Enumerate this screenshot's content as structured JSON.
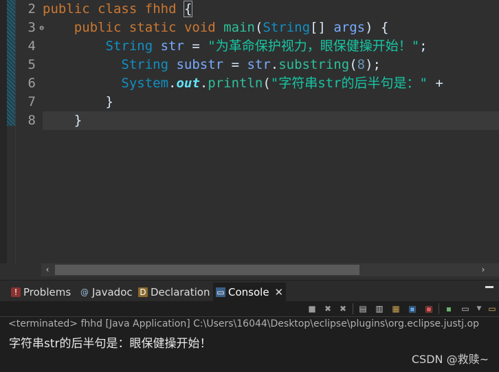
{
  "editor": {
    "line_numbers": [
      "2",
      "3",
      "4",
      "5",
      "6",
      "7",
      "8"
    ],
    "lines": [
      {
        "parts": [
          [
            "kw",
            "public"
          ],
          [
            "plain",
            " "
          ],
          [
            "kw",
            "class"
          ],
          [
            "plain",
            " "
          ],
          [
            "kw",
            "fhhd"
          ],
          [
            "plain",
            " "
          ],
          [
            "brace",
            "{"
          ]
        ]
      },
      {
        "parts": [
          [
            "plain",
            "    "
          ],
          [
            "kw",
            "public"
          ],
          [
            "plain",
            " "
          ],
          [
            "kw",
            "static"
          ],
          [
            "plain",
            " "
          ],
          [
            "kw",
            "void"
          ],
          [
            "plain",
            " "
          ],
          [
            "fn",
            "main"
          ],
          [
            "plain",
            "("
          ],
          [
            "ty",
            "String"
          ],
          [
            "plain",
            "[] "
          ],
          [
            "var",
            "args"
          ],
          [
            "plain",
            ") {"
          ]
        ]
      },
      {
        "parts": [
          [
            "plain",
            "        "
          ],
          [
            "ty",
            "String"
          ],
          [
            "plain",
            " "
          ],
          [
            "var",
            "str"
          ],
          [
            "plain",
            " = "
          ],
          [
            "str",
            "\"为革命保护视力，眼保健操开始！\""
          ],
          [
            "plain",
            ";"
          ]
        ]
      },
      {
        "parts": [
          [
            "plain",
            "          "
          ],
          [
            "ty",
            "String"
          ],
          [
            "plain",
            " "
          ],
          [
            "var",
            "substr"
          ],
          [
            "plain",
            " = "
          ],
          [
            "var",
            "str"
          ],
          [
            "plain",
            "."
          ],
          [
            "fn",
            "substring"
          ],
          [
            "plain",
            "("
          ],
          [
            "num",
            "8"
          ],
          [
            "plain",
            ");"
          ]
        ]
      },
      {
        "parts": [
          [
            "plain",
            "          "
          ],
          [
            "ty",
            "System"
          ],
          [
            "plain",
            "."
          ],
          [
            "field",
            "out"
          ],
          [
            "plain",
            "."
          ],
          [
            "fn",
            "println"
          ],
          [
            "plain",
            "("
          ],
          [
            "str",
            "\"字符串str的后半句是：\""
          ],
          [
            "plain",
            " +"
          ]
        ]
      },
      {
        "parts": [
          [
            "plain",
            "        }"
          ]
        ]
      },
      {
        "parts": [
          [
            "plain",
            "    }"
          ]
        ]
      }
    ]
  },
  "panel": {
    "tabs": [
      {
        "label": "Problems",
        "icon": "problems-icon"
      },
      {
        "label": "Javadoc",
        "icon": "javadoc-icon"
      },
      {
        "label": "Declaration",
        "icon": "declaration-icon"
      },
      {
        "label": "Console",
        "icon": "console-icon",
        "active": true
      }
    ],
    "console_description": "<terminated> fhhd [Java Application] C:\\Users\\16044\\Desktop\\eclipse\\plugins\\org.eclipse.justj.op",
    "console_output": "字符串str的后半句是：眼保健操开始！"
  },
  "watermark": "CSDN @救赎~"
}
